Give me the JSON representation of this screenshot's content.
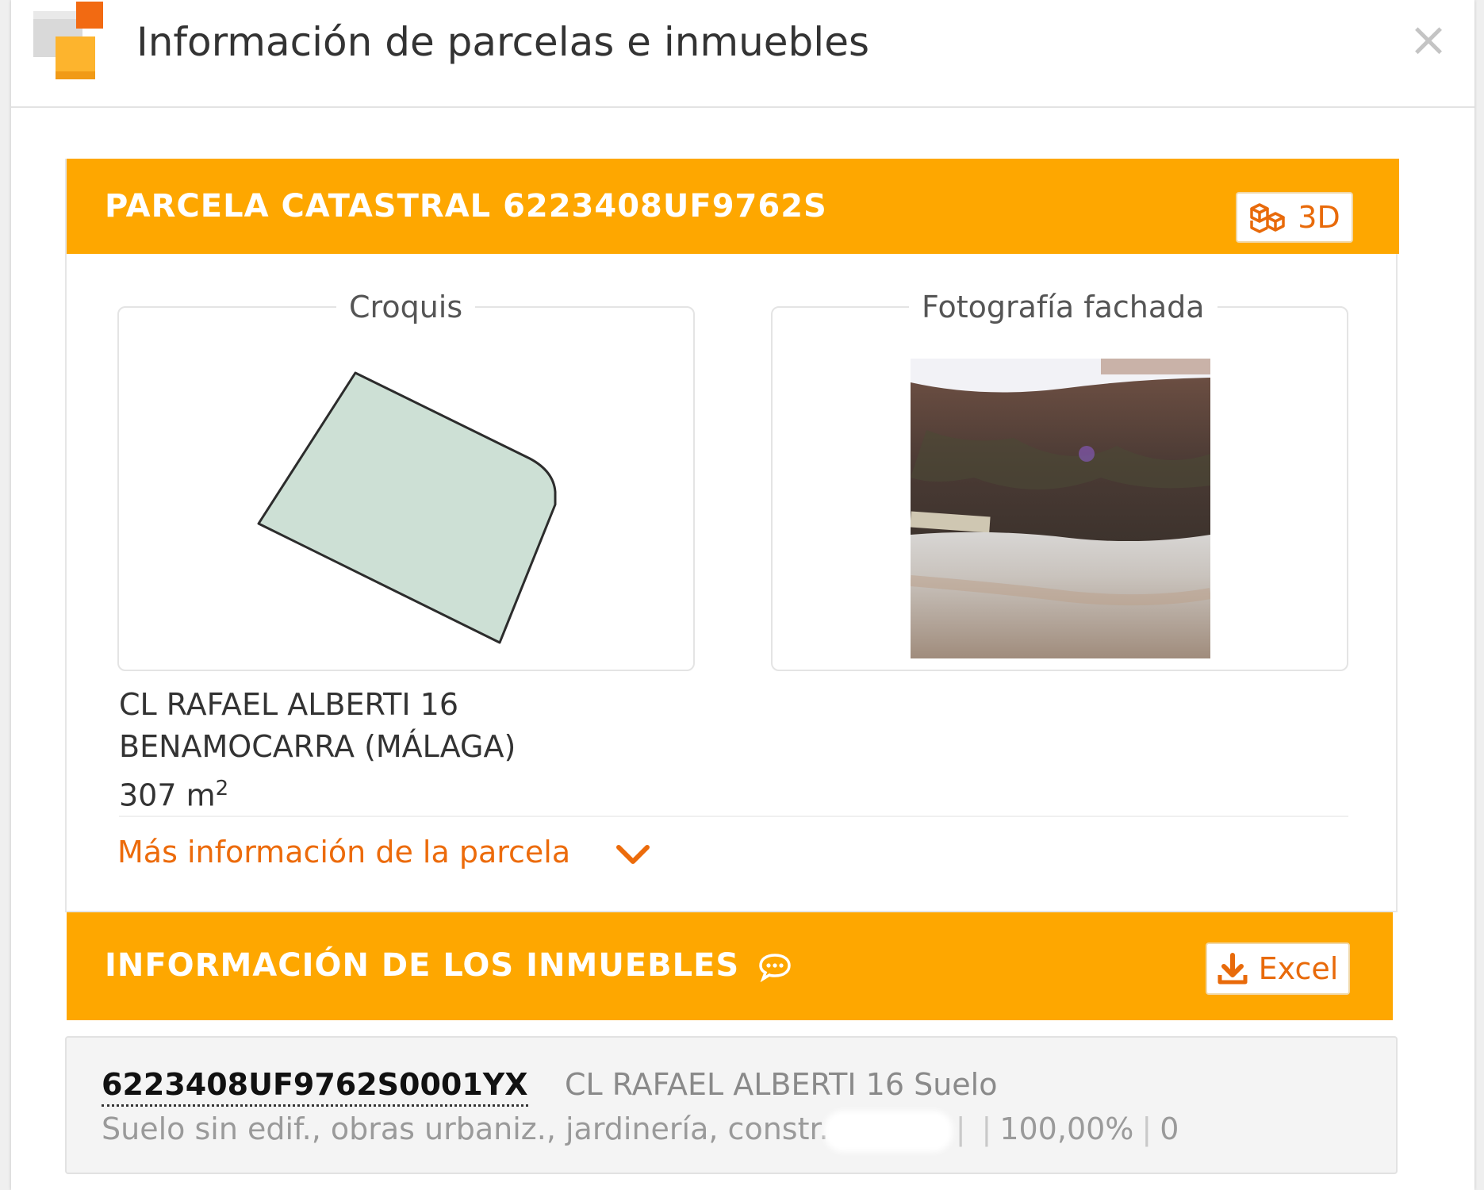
{
  "dialog": {
    "title": "Información de parcelas e inmuebles",
    "close_label": "×"
  },
  "parcel": {
    "header": "PARCELA CATASTRAL 6223408UF9762S",
    "btn_3d_label": "3D",
    "sketch": {
      "legend": "Croquis"
    },
    "photo": {
      "legend": "Fotografía fachada"
    },
    "address_line1": "CL RAFAEL ALBERTI 16",
    "address_line2": "BENAMOCARRA (MÁLAGA)",
    "area_value": "307 m",
    "area_sup": "2",
    "more_info_label": "Más información de la parcela"
  },
  "properties": {
    "header": "INFORMACIÓN DE LOS INMUEBLES",
    "excel_label": "Excel",
    "rows": [
      {
        "ref": "6223408UF9762S0001YX",
        "address": "CL RAFAEL ALBERTI 16 Suelo",
        "use": "Suelo sin edif., obras urbaniz., jardinería, constr.",
        "percentage": "100,00%",
        "year": "0"
      }
    ]
  },
  "colors": {
    "accent_orange": "#fea700",
    "link_orange": "#ec6b0b",
    "parcel_fill": "#cde0d5"
  },
  "icons": {
    "logo": "catastro-logo-icon",
    "close": "close-icon",
    "three_d": "cubes-icon",
    "info": "speech-bubble-icon",
    "excel": "download-icon",
    "expand": "chevron-down-icon"
  }
}
